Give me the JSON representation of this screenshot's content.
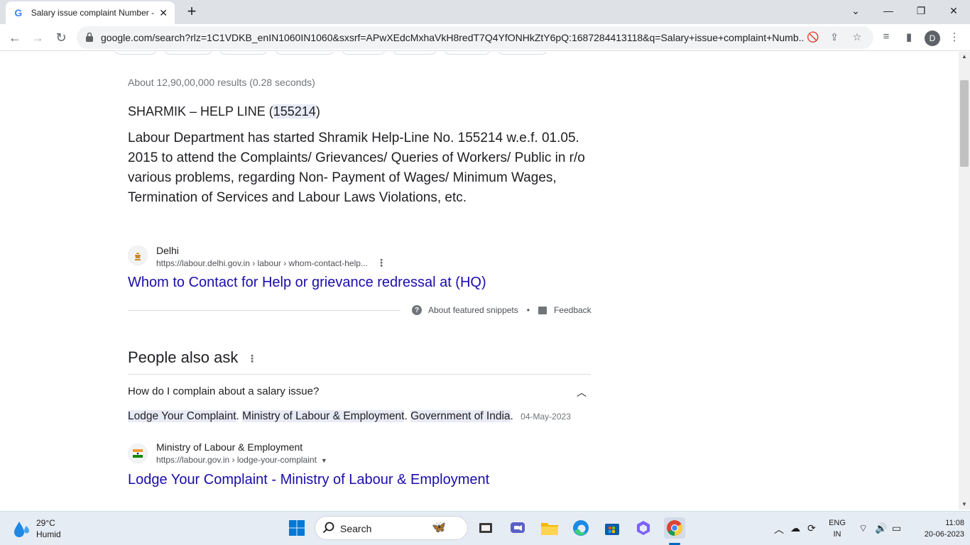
{
  "browser": {
    "tab_title": "Salary issue complaint Number -",
    "favicon": "G",
    "url": "google.com/search?rlz=1C1VDKB_enIN1060IN1060&sxsrf=APwXEdcMxhaVkH8redT7Q4YfONHkZtY6pQ:1687284413118&q=Salary+issue+complaint+Numb...",
    "profile_initial": "D"
  },
  "results": {
    "stats": "About 12,90,00,000 results (0.28 seconds)",
    "snippet": {
      "title_prefix": "SHARMIK – HELP LINE (",
      "title_number": "155214",
      "title_suffix": ")",
      "body": "Labour Department has started Shramik Help-Line No. 155214 w.e.f. 01.05. 2015 to attend the Complaints/ Grievances/ Queries of Workers/ Public in r/o various problems, regarding Non- Payment of Wages/ Minimum Wages, Termination of Services and Labour Laws Violations, etc.",
      "source_name": "Delhi",
      "source_url": "https://labour.delhi.gov.in › labour › whom-contact-help...",
      "link_text": "Whom to Contact for Help or grievance redressal at (HQ)",
      "about_label": "About featured snippets",
      "separator": "•",
      "feedback_label": "Feedback"
    },
    "paa": {
      "title": "People also ask",
      "question": "How do I complain about a salary issue?",
      "answer_part1": "Lodge Your Complaint",
      "answer_part2": "Ministry of Labour & Employment",
      "answer_part3": "Government of India",
      "answer_date": "04-May-2023",
      "source_name": "Ministry of Labour & Employment",
      "source_url": "https://labour.gov.in › lodge-your-complaint",
      "link_text": "Lodge Your Complaint - Ministry of Labour & Employment"
    }
  },
  "taskbar": {
    "weather_temp": "29°C",
    "weather_desc": "Humid",
    "search_label": "Search",
    "lang_top": "ENG",
    "lang_bottom": "IN",
    "time": "11:08",
    "date": "20-06-2023"
  }
}
